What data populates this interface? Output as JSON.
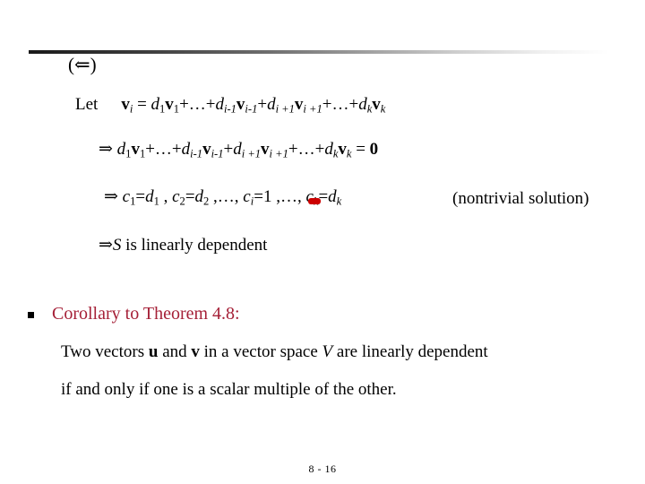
{
  "slide": {
    "footer": "8 - 16",
    "accent_color": "#a52037",
    "mark_color": "#cc0000",
    "rule_color_dark": "#1a1a1a"
  },
  "proof": {
    "direction_marker": "(⇐)",
    "let_word": "Let",
    "let_equation": {
      "lhs_vector": "v",
      "lhs_sub": "i",
      "equals": "=",
      "terms": [
        {
          "coef": "d",
          "coef_sub": "1",
          "vec": "v",
          "vec_sub": "1"
        },
        {
          "coef": "",
          "coef_sub": "",
          "vec": "",
          "vec_sub": "",
          "ellipsis": "…"
        },
        {
          "coef": "d",
          "coef_sub": "i-1",
          "vec": "v",
          "vec_sub": "i-1"
        },
        {
          "coef": "d",
          "coef_sub": "i +1",
          "vec": "v",
          "vec_sub": "i +1"
        },
        {
          "coef": "",
          "coef_sub": "",
          "vec": "",
          "vec_sub": "",
          "ellipsis": "…"
        },
        {
          "coef": "d",
          "coef_sub": "k",
          "vec": "v",
          "vec_sub": "k"
        }
      ],
      "plain": "v_i = d_1 v_1 + … + d_{i-1} v_{i-1} + d_{i+1} v_{i+1} + … + d_k v_k"
    },
    "implies_symbol": "⇒",
    "zero_equation_plain": "⇒ d_1 v_1 + … + d_{i-1} v_{i-1} + d_{i+1} v_{i+1} + … + d_k v_k = 0",
    "zero_rhs": "0",
    "coefficients_line": {
      "items": [
        {
          "lhs": "c",
          "lhs_sub": "1",
          "rhs": "d",
          "rhs_sub": "1"
        },
        {
          "lhs": "c",
          "lhs_sub": "2",
          "rhs": "d",
          "rhs_sub": "2"
        },
        {
          "lhs": "c",
          "lhs_sub": "i",
          "rhs": "1",
          "rhs_sub": ""
        },
        {
          "lhs": "c",
          "lhs_sub": "k",
          "rhs": "d",
          "rhs_sub": "k"
        }
      ],
      "separator": ",",
      "ellipsis": "…",
      "plain": "⇒ c_1=d_1 , c_2=d_2 ,…, c_i=1 ,…, c_k=d_k"
    },
    "nontrivial_note": "(nontrivial solution)",
    "conclusion": {
      "symbol": "⇒",
      "set_name": "S",
      "text": " is linearly dependent"
    }
  },
  "corollary": {
    "bullet": "square-bullet",
    "title": "Corollary to Theorem 4.8:",
    "line1": {
      "before_u": "Two vectors ",
      "u": "u",
      "between": " and ",
      "v": "v",
      "after_v": " in a vector space ",
      "space_name": "V",
      "tail": " are linearly dependent"
    },
    "line2": "if and only if one is a scalar multiple of the other."
  }
}
